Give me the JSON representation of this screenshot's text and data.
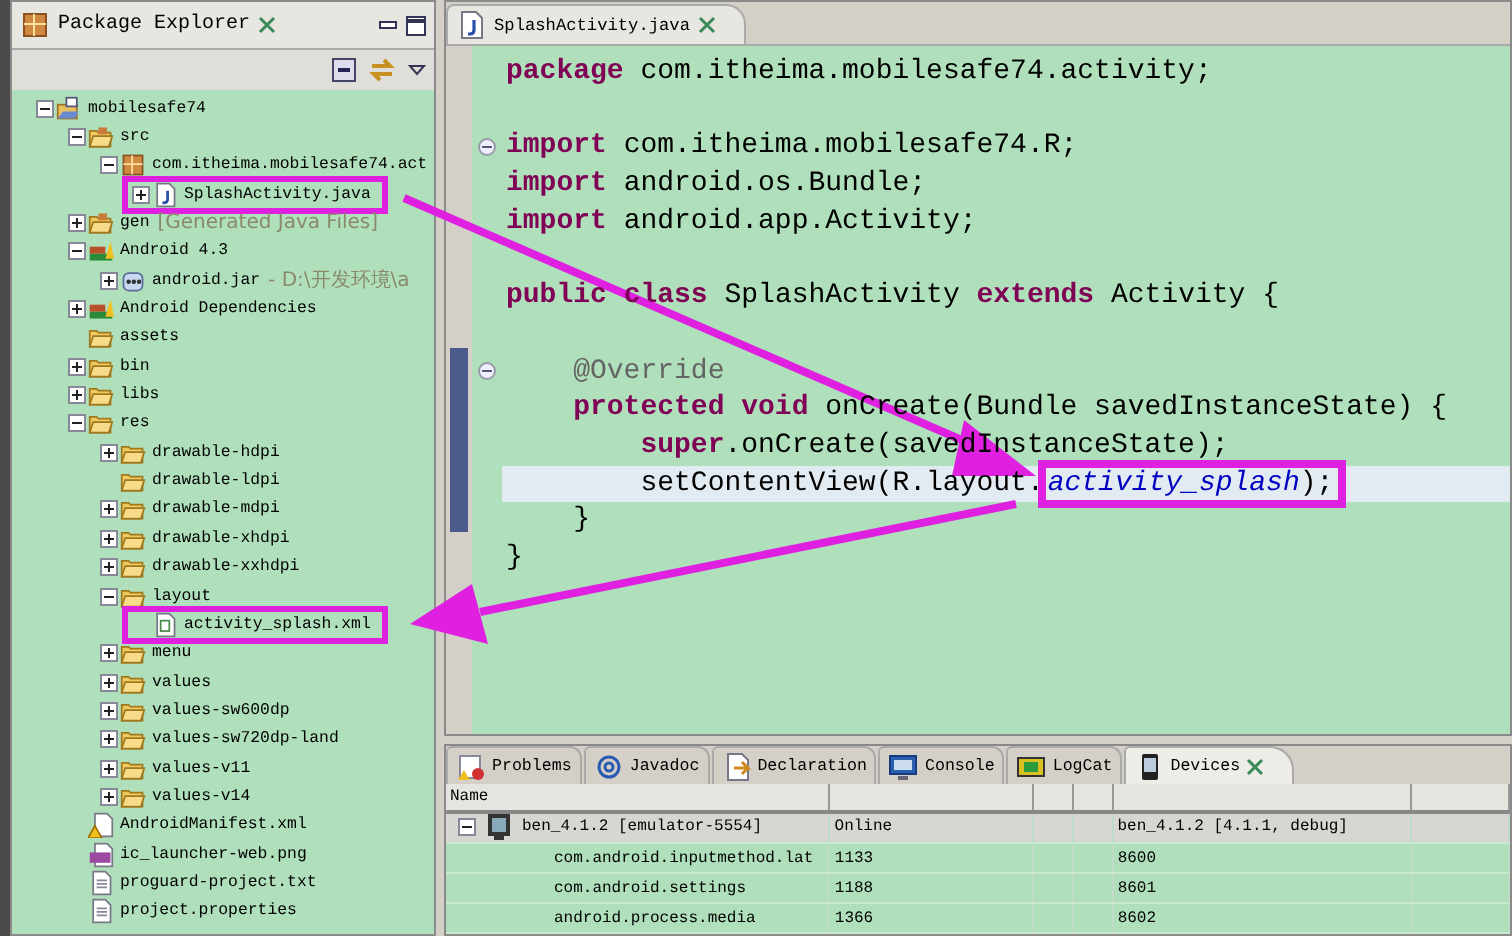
{
  "explorer": {
    "title": "Package Explorer",
    "tree": [
      {
        "label": "mobilesafe74",
        "kind": "project",
        "expanded": true,
        "children": [
          {
            "label": "src",
            "kind": "srcfolder",
            "expanded": true,
            "children": [
              {
                "label": "com.itheima.mobilesafe74.act",
                "kind": "package",
                "expanded": true,
                "children": [
                  {
                    "label": "SplashActivity.java",
                    "kind": "javafile",
                    "expanded": false,
                    "highlighted": true
                  }
                ]
              }
            ]
          },
          {
            "label": "gen",
            "decoration": "[Generated Java Files]",
            "kind": "srcfolder",
            "expanded": false
          },
          {
            "label": "Android 4.3",
            "kind": "library",
            "expanded": true,
            "children": [
              {
                "label": "android.jar",
                "decoration": "- D:\\开发环境\\a",
                "kind": "jar",
                "expanded": false
              }
            ]
          },
          {
            "label": "Android Dependencies",
            "kind": "library",
            "expanded": false
          },
          {
            "label": "assets",
            "kind": "folder"
          },
          {
            "label": "bin",
            "kind": "folder",
            "expanded": false
          },
          {
            "label": "libs",
            "kind": "folder",
            "expanded": false
          },
          {
            "label": "res",
            "kind": "folder",
            "expanded": true,
            "children": [
              {
                "label": "drawable-hdpi",
                "kind": "folder",
                "expanded": false
              },
              {
                "label": "drawable-ldpi",
                "kind": "folder"
              },
              {
                "label": "drawable-mdpi",
                "kind": "folder",
                "expanded": false
              },
              {
                "label": "drawable-xhdpi",
                "kind": "folder",
                "expanded": false
              },
              {
                "label": "drawable-xxhdpi",
                "kind": "folder",
                "expanded": false
              },
              {
                "label": "layout",
                "kind": "folder",
                "expanded": true,
                "children": [
                  {
                    "label": "activity_splash.xml",
                    "kind": "xmlfile",
                    "highlighted": true
                  }
                ]
              },
              {
                "label": "menu",
                "kind": "folder",
                "expanded": false
              },
              {
                "label": "values",
                "kind": "folder",
                "expanded": false
              },
              {
                "label": "values-sw600dp",
                "kind": "folder",
                "expanded": false
              },
              {
                "label": "values-sw720dp-land",
                "kind": "folder",
                "expanded": false
              },
              {
                "label": "values-v11",
                "kind": "folder",
                "expanded": false
              },
              {
                "label": "values-v14",
                "kind": "folder",
                "expanded": false
              }
            ]
          },
          {
            "label": "AndroidManifest.xml",
            "kind": "manifest"
          },
          {
            "label": "ic_launcher-web.png",
            "kind": "png"
          },
          {
            "label": "proguard-project.txt",
            "kind": "txtfile"
          },
          {
            "label": "project.properties",
            "kind": "txtfile"
          }
        ]
      }
    ]
  },
  "editor": {
    "tab": "SplashActivity.java",
    "lines": [
      {
        "kind": "code",
        "segments": [
          {
            "text": "package",
            "kind": "keyword"
          },
          {
            "text": " com.itheima.mobilesafe74.activity;",
            "kind": "plain"
          }
        ]
      },
      {
        "kind": "blank"
      },
      {
        "kind": "code",
        "fold": true,
        "segments": [
          {
            "text": "import",
            "kind": "keyword"
          },
          {
            "text": " com.itheima.mobilesafe74.R;",
            "kind": "plain"
          }
        ]
      },
      {
        "kind": "code",
        "segments": [
          {
            "text": "import",
            "kind": "keyword"
          },
          {
            "text": " android.os.Bundle;",
            "kind": "plain"
          }
        ]
      },
      {
        "kind": "code",
        "segments": [
          {
            "text": "import",
            "kind": "keyword"
          },
          {
            "text": " android.app.Activity;",
            "kind": "plain"
          }
        ]
      },
      {
        "kind": "blank"
      },
      {
        "kind": "code",
        "segments": [
          {
            "text": "public",
            "kind": "keyword"
          },
          {
            "text": " class",
            "kind": "keyword"
          },
          {
            "text": " SplashActivity ",
            "kind": "plain"
          },
          {
            "text": "extends",
            "kind": "keyword"
          },
          {
            "text": " Activity {",
            "kind": "plain"
          }
        ]
      },
      {
        "kind": "blank"
      },
      {
        "kind": "code",
        "fold": true,
        "segments": [
          {
            "text": "    @Override",
            "kind": "annotation"
          }
        ]
      },
      {
        "kind": "code",
        "segments": [
          {
            "text": "    protected",
            "kind": "keyword"
          },
          {
            "text": " void",
            "kind": "keyword"
          },
          {
            "text": " onCreate(Bundle savedInstanceState) {",
            "kind": "plain"
          }
        ]
      },
      {
        "kind": "code",
        "segments": [
          {
            "text": "        super",
            "kind": "keyword"
          },
          {
            "text": ".onCreate(savedInstanceState);",
            "kind": "plain"
          }
        ]
      },
      {
        "kind": "code",
        "current": true,
        "segments": [
          {
            "text": "        setContentView(R.layout.",
            "kind": "plain"
          },
          {
            "text": "activity_splash",
            "kind": "field",
            "highlighted": true
          },
          {
            "text": ");",
            "kind": "plain",
            "highlighted": true
          }
        ]
      },
      {
        "kind": "code",
        "segments": [
          {
            "text": "    }",
            "kind": "plain"
          }
        ]
      },
      {
        "kind": "code",
        "segments": [
          {
            "text": "}",
            "kind": "plain"
          }
        ]
      }
    ]
  },
  "bottom_panel": {
    "tabs": [
      {
        "label": "Problems",
        "kind": "problems",
        "selected": false
      },
      {
        "label": "Javadoc",
        "kind": "javadoc",
        "selected": false
      },
      {
        "label": "Declaration",
        "kind": "declaration",
        "selected": false
      },
      {
        "label": "Console",
        "kind": "console",
        "selected": false
      },
      {
        "label": "LogCat",
        "kind": "logcat",
        "selected": false
      },
      {
        "label": "Devices",
        "kind": "devices",
        "selected": true
      }
    ],
    "table": {
      "columns": [
        "Name"
      ],
      "rows": [
        {
          "kind": "device",
          "expanded": true,
          "name": "ben_4.1.2 [emulator-5554]",
          "column_2": "Online",
          "column_5": "ben_4.1.2 [4.1.1, debug]"
        },
        {
          "kind": "process",
          "name": "com.android.inputmethod.lat",
          "column_2": "1133",
          "column_5": "8600"
        },
        {
          "kind": "process",
          "name": "com.android.settings",
          "column_2": "1188",
          "column_5": "8601"
        },
        {
          "kind": "process",
          "name": "android.process.media",
          "column_2": "1366",
          "column_5": "8602"
        }
      ]
    }
  }
}
